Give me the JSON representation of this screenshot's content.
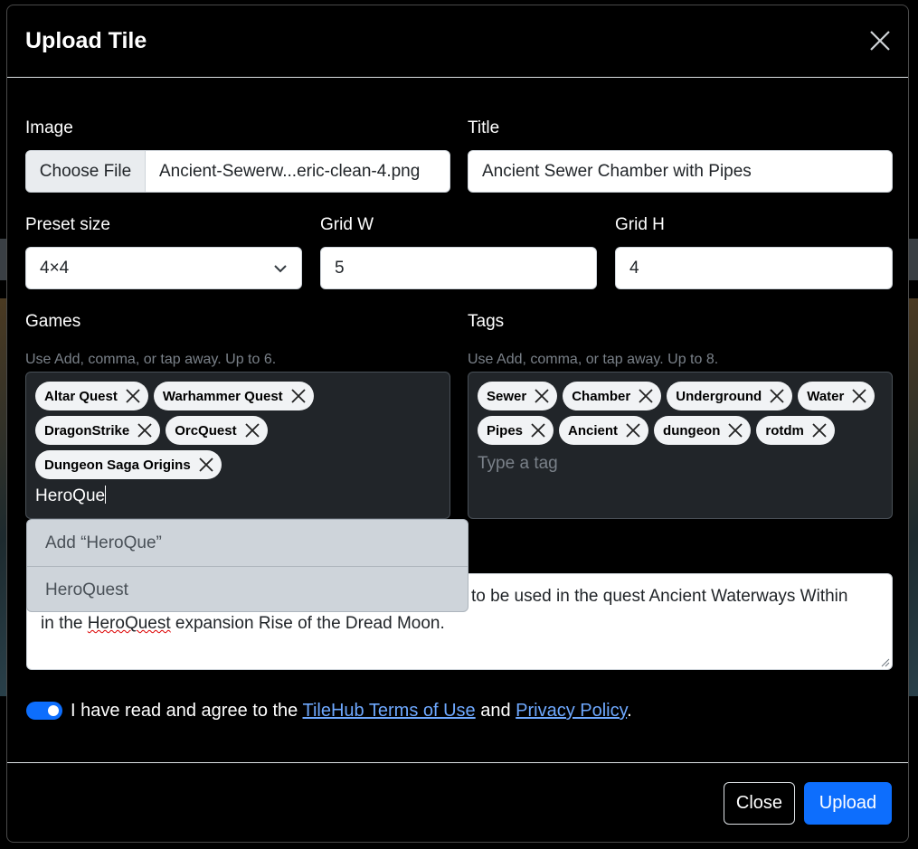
{
  "modal": {
    "title": "Upload Tile"
  },
  "form": {
    "image_label": "Image",
    "choose_file_label": "Choose File",
    "file_name": "Ancient-Sewerw...eric-clean-4.png",
    "title_label": "Title",
    "title_value": "Ancient Sewer Chamber with Pipes",
    "preset_label": "Preset size",
    "preset_value": "4×4",
    "grid_w_label": "Grid W",
    "grid_w_value": "5",
    "grid_h_label": "Grid H",
    "grid_h_value": "4"
  },
  "games": {
    "label": "Games",
    "help": "Use Add, comma, or tap away. Up to 6.",
    "chips": [
      "Altar Quest",
      "Warhammer Quest",
      "DragonStrike",
      "OrcQuest",
      "Dungeon Saga Origins"
    ],
    "input_value": "HeroQue"
  },
  "tags": {
    "label": "Tags",
    "help": "Use Add, comma, or tap away. Up to 8.",
    "chips": [
      "Sewer",
      "Chamber",
      "Underground",
      "Water",
      "Pipes",
      "Ancient",
      "dungeon",
      "rotdm"
    ],
    "placeholder": "Type a tag"
  },
  "dropdown": {
    "items": [
      "Add “HeroQue”",
      "HeroQuest"
    ]
  },
  "description": {
    "line1": "to be used in the quest Ancient Waterways Within",
    "line2_prefix": "in the ",
    "line2_misspelled": "HeroQuest",
    "line2_suffix": " expansion Rise of the Dread Moon."
  },
  "agreement": {
    "prefix": "I have read and agree to the ",
    "terms_link": "TileHub Terms of Use",
    "middle": " and ",
    "privacy_link": "Privacy Policy",
    "suffix": ".",
    "checked": true
  },
  "footer": {
    "close_label": "Close",
    "upload_label": "Upload"
  },
  "colors": {
    "accent": "#0d6efd",
    "link": "#6ea8fe"
  }
}
